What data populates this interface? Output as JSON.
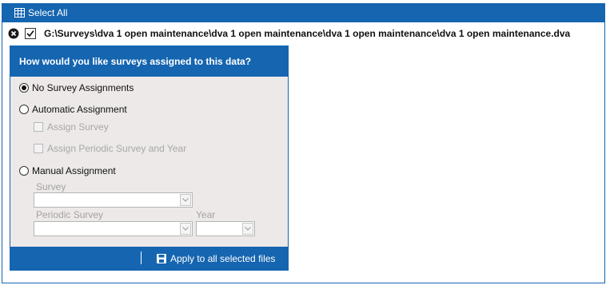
{
  "header": {
    "select_all_label": "Select All"
  },
  "file": {
    "path": "G:\\Surveys\\dva 1 open maintenance\\dva 1 open maintenance\\dva 1 open maintenance\\dva 1 open maintenance.dva",
    "checked": true
  },
  "panel": {
    "title": "How would you like surveys assigned to this data?",
    "options": {
      "none": "No Survey Assignments",
      "automatic": "Automatic Assignment",
      "assign_survey": "Assign Survey",
      "assign_periodic": "Assign Periodic Survey and Year",
      "manual": "Manual Assignment"
    },
    "selected_option": "No Survey Assignments",
    "fields": {
      "survey_label": "Survey",
      "periodic_label": "Periodic Survey",
      "year_label": "Year",
      "survey_value": "",
      "periodic_value": "",
      "year_value": ""
    },
    "apply_label": "Apply to all selected files"
  },
  "colors": {
    "accent": "#1565b0",
    "panel_bg": "#ece9e8",
    "disabled_text": "#a8a8a8"
  },
  "icons": {
    "select_all": "table-grid-icon",
    "remove": "close-circle-icon",
    "apply": "save-disk-icon",
    "dropdown": "chevron-down-icon"
  }
}
